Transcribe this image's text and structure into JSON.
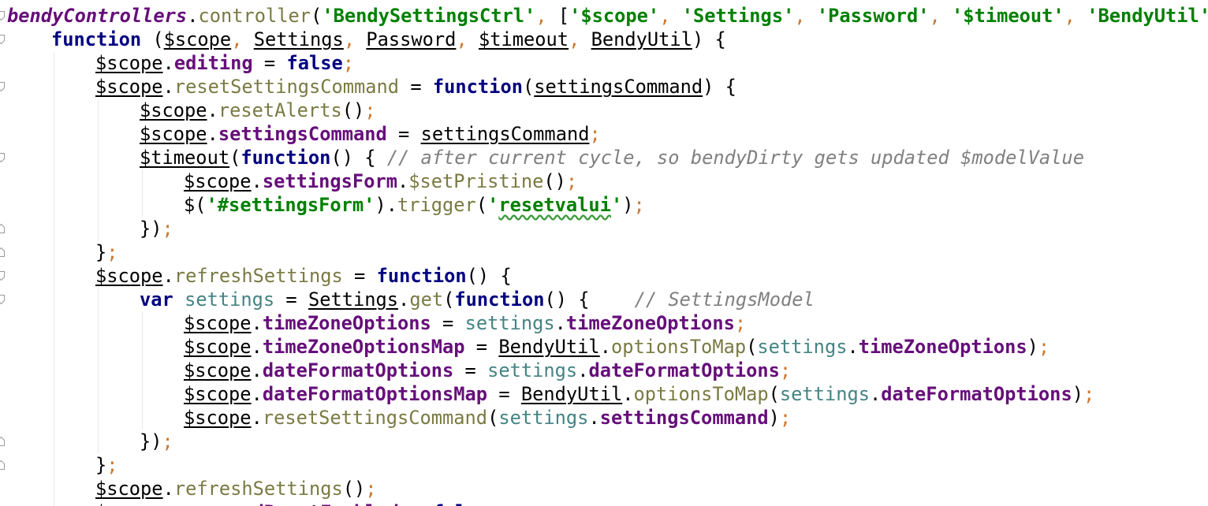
{
  "colors": {
    "keyword": "#000080",
    "string": "#008000",
    "comment": "#808080",
    "property": "#660e7a",
    "method": "#7a7a43",
    "variable": "#458383",
    "punct_orange": "#cc7832",
    "plain": "#000000",
    "indent_guide": "#e8e8e8",
    "gutter_icon": "#9a9a9a"
  },
  "code": {
    "lines": [
      {
        "indent": 0,
        "tokens": [
          {
            "t": "bendyControllers",
            "c": "property",
            "b": true,
            "i": true
          },
          {
            "t": ".",
            "c": "plain"
          },
          {
            "t": "controller",
            "c": "method"
          },
          {
            "t": "(",
            "c": "plain"
          },
          {
            "t": "'BendySettingsCtrl'",
            "c": "string",
            "b": true
          },
          {
            "t": ", ",
            "c": "punct_orange"
          },
          {
            "t": "[",
            "c": "plain"
          },
          {
            "t": "'$scope'",
            "c": "string",
            "b": true
          },
          {
            "t": ", ",
            "c": "punct_orange"
          },
          {
            "t": "'Settings'",
            "c": "string",
            "b": true
          },
          {
            "t": ", ",
            "c": "punct_orange"
          },
          {
            "t": "'Password'",
            "c": "string",
            "b": true
          },
          {
            "t": ", ",
            "c": "punct_orange"
          },
          {
            "t": "'$timeout'",
            "c": "string",
            "b": true
          },
          {
            "t": ", ",
            "c": "punct_orange"
          },
          {
            "t": "'BendyUtil'",
            "c": "string",
            "b": true
          },
          {
            "t": ",",
            "c": "punct_orange"
          }
        ]
      },
      {
        "indent": 1,
        "tokens": [
          {
            "t": "function",
            "c": "keyword",
            "b": true
          },
          {
            "t": " (",
            "c": "plain"
          },
          {
            "t": "$scope",
            "c": "plain",
            "u": true
          },
          {
            "t": ", ",
            "c": "punct_orange"
          },
          {
            "t": "Settings",
            "c": "plain",
            "u": true
          },
          {
            "t": ", ",
            "c": "punct_orange"
          },
          {
            "t": "Password",
            "c": "plain",
            "u": true
          },
          {
            "t": ", ",
            "c": "punct_orange"
          },
          {
            "t": "$timeout",
            "c": "plain",
            "u": true
          },
          {
            "t": ", ",
            "c": "punct_orange"
          },
          {
            "t": "BendyUtil",
            "c": "plain",
            "u": true
          },
          {
            "t": ") {",
            "c": "plain"
          }
        ]
      },
      {
        "indent": 2,
        "tokens": [
          {
            "t": "$scope",
            "c": "plain",
            "u": true
          },
          {
            "t": ".",
            "c": "plain"
          },
          {
            "t": "editing",
            "c": "property",
            "b": true
          },
          {
            "t": " = ",
            "c": "plain"
          },
          {
            "t": "false",
            "c": "keyword",
            "b": true
          },
          {
            "t": ";",
            "c": "punct_orange"
          }
        ]
      },
      {
        "indent": 2,
        "tokens": [
          {
            "t": "$scope",
            "c": "plain",
            "u": true
          },
          {
            "t": ".",
            "c": "plain"
          },
          {
            "t": "resetSettingsCommand",
            "c": "method"
          },
          {
            "t": " = ",
            "c": "plain"
          },
          {
            "t": "function",
            "c": "keyword",
            "b": true
          },
          {
            "t": "(",
            "c": "plain"
          },
          {
            "t": "settingsCommand",
            "c": "plain",
            "u": true
          },
          {
            "t": ") {",
            "c": "plain"
          }
        ]
      },
      {
        "indent": 3,
        "tokens": [
          {
            "t": "$scope",
            "c": "plain",
            "u": true
          },
          {
            "t": ".",
            "c": "plain"
          },
          {
            "t": "resetAlerts",
            "c": "method"
          },
          {
            "t": "()",
            "c": "plain"
          },
          {
            "t": ";",
            "c": "punct_orange"
          }
        ]
      },
      {
        "indent": 3,
        "tokens": [
          {
            "t": "$scope",
            "c": "plain",
            "u": true
          },
          {
            "t": ".",
            "c": "plain"
          },
          {
            "t": "settingsCommand",
            "c": "property",
            "b": true
          },
          {
            "t": " = ",
            "c": "plain"
          },
          {
            "t": "settingsCommand",
            "c": "plain",
            "u": true
          },
          {
            "t": ";",
            "c": "punct_orange"
          }
        ]
      },
      {
        "indent": 3,
        "tokens": [
          {
            "t": "$timeout",
            "c": "plain",
            "u": true
          },
          {
            "t": "(",
            "c": "plain"
          },
          {
            "t": "function",
            "c": "keyword",
            "b": true
          },
          {
            "t": "() { ",
            "c": "plain"
          },
          {
            "t": "// after current cycle, so bendyDirty gets updated $modelValue",
            "c": "comment",
            "i": true
          }
        ]
      },
      {
        "indent": 4,
        "tokens": [
          {
            "t": "$scope",
            "c": "plain",
            "u": true
          },
          {
            "t": ".",
            "c": "plain"
          },
          {
            "t": "settingsForm",
            "c": "property",
            "b": true
          },
          {
            "t": ".",
            "c": "plain"
          },
          {
            "t": "$setPristine",
            "c": "method"
          },
          {
            "t": "()",
            "c": "plain"
          },
          {
            "t": ";",
            "c": "punct_orange"
          }
        ]
      },
      {
        "indent": 4,
        "tokens": [
          {
            "t": "$(",
            "c": "plain"
          },
          {
            "t": "'#settingsForm'",
            "c": "string",
            "b": true
          },
          {
            "t": ").",
            "c": "plain"
          },
          {
            "t": "trigger",
            "c": "method"
          },
          {
            "t": "(",
            "c": "plain"
          },
          {
            "t": "'",
            "c": "string",
            "b": true
          },
          {
            "t": "resetvalui",
            "c": "string",
            "b": true,
            "wavy": true
          },
          {
            "t": "'",
            "c": "string",
            "b": true
          },
          {
            "t": ")",
            "c": "plain"
          },
          {
            "t": ";",
            "c": "punct_orange"
          }
        ]
      },
      {
        "indent": 3,
        "tokens": [
          {
            "t": "})",
            "c": "plain"
          },
          {
            "t": ";",
            "c": "punct_orange"
          }
        ]
      },
      {
        "indent": 2,
        "tokens": [
          {
            "t": "}",
            "c": "plain"
          },
          {
            "t": ";",
            "c": "punct_orange"
          }
        ]
      },
      {
        "indent": 2,
        "tokens": [
          {
            "t": "$scope",
            "c": "plain",
            "u": true
          },
          {
            "t": ".",
            "c": "plain"
          },
          {
            "t": "refreshSettings",
            "c": "method"
          },
          {
            "t": " = ",
            "c": "plain"
          },
          {
            "t": "function",
            "c": "keyword",
            "b": true
          },
          {
            "t": "() {",
            "c": "plain"
          }
        ]
      },
      {
        "indent": 3,
        "tokens": [
          {
            "t": "var",
            "c": "keyword",
            "b": true
          },
          {
            "t": " ",
            "c": "plain"
          },
          {
            "t": "settings",
            "c": "variable"
          },
          {
            "t": " = ",
            "c": "plain"
          },
          {
            "t": "Settings",
            "c": "plain",
            "u": true
          },
          {
            "t": ".",
            "c": "plain"
          },
          {
            "t": "get",
            "c": "method"
          },
          {
            "t": "(",
            "c": "plain"
          },
          {
            "t": "function",
            "c": "keyword",
            "b": true
          },
          {
            "t": "() {    ",
            "c": "plain"
          },
          {
            "t": "// SettingsModel",
            "c": "comment",
            "i": true
          }
        ]
      },
      {
        "indent": 4,
        "tokens": [
          {
            "t": "$scope",
            "c": "plain",
            "u": true
          },
          {
            "t": ".",
            "c": "plain"
          },
          {
            "t": "timeZoneOptions",
            "c": "property",
            "b": true
          },
          {
            "t": " = ",
            "c": "plain"
          },
          {
            "t": "settings",
            "c": "variable"
          },
          {
            "t": ".",
            "c": "plain"
          },
          {
            "t": "timeZoneOptions",
            "c": "property",
            "b": true
          },
          {
            "t": ";",
            "c": "punct_orange"
          }
        ]
      },
      {
        "indent": 4,
        "tokens": [
          {
            "t": "$scope",
            "c": "plain",
            "u": true
          },
          {
            "t": ".",
            "c": "plain"
          },
          {
            "t": "timeZoneOptionsMap",
            "c": "property",
            "b": true
          },
          {
            "t": " = ",
            "c": "plain"
          },
          {
            "t": "BendyUtil",
            "c": "plain",
            "u": true
          },
          {
            "t": ".",
            "c": "plain"
          },
          {
            "t": "optionsToMap",
            "c": "method"
          },
          {
            "t": "(",
            "c": "plain"
          },
          {
            "t": "settings",
            "c": "variable"
          },
          {
            "t": ".",
            "c": "plain"
          },
          {
            "t": "timeZoneOptions",
            "c": "property",
            "b": true
          },
          {
            "t": ")",
            "c": "plain"
          },
          {
            "t": ";",
            "c": "punct_orange"
          }
        ]
      },
      {
        "indent": 4,
        "tokens": [
          {
            "t": "$scope",
            "c": "plain",
            "u": true
          },
          {
            "t": ".",
            "c": "plain"
          },
          {
            "t": "dateFormatOptions",
            "c": "property",
            "b": true
          },
          {
            "t": " = ",
            "c": "plain"
          },
          {
            "t": "settings",
            "c": "variable"
          },
          {
            "t": ".",
            "c": "plain"
          },
          {
            "t": "dateFormatOptions",
            "c": "property",
            "b": true
          },
          {
            "t": ";",
            "c": "punct_orange"
          }
        ]
      },
      {
        "indent": 4,
        "tokens": [
          {
            "t": "$scope",
            "c": "plain",
            "u": true
          },
          {
            "t": ".",
            "c": "plain"
          },
          {
            "t": "dateFormatOptionsMap",
            "c": "property",
            "b": true
          },
          {
            "t": " = ",
            "c": "plain"
          },
          {
            "t": "BendyUtil",
            "c": "plain",
            "u": true
          },
          {
            "t": ".",
            "c": "plain"
          },
          {
            "t": "optionsToMap",
            "c": "method"
          },
          {
            "t": "(",
            "c": "plain"
          },
          {
            "t": "settings",
            "c": "variable"
          },
          {
            "t": ".",
            "c": "plain"
          },
          {
            "t": "dateFormatOptions",
            "c": "property",
            "b": true
          },
          {
            "t": ")",
            "c": "plain"
          },
          {
            "t": ";",
            "c": "punct_orange"
          }
        ]
      },
      {
        "indent": 4,
        "tokens": [
          {
            "t": "$scope",
            "c": "plain",
            "u": true
          },
          {
            "t": ".",
            "c": "plain"
          },
          {
            "t": "resetSettingsCommand",
            "c": "method"
          },
          {
            "t": "(",
            "c": "plain"
          },
          {
            "t": "settings",
            "c": "variable"
          },
          {
            "t": ".",
            "c": "plain"
          },
          {
            "t": "settingsCommand",
            "c": "property",
            "b": true
          },
          {
            "t": ")",
            "c": "plain"
          },
          {
            "t": ";",
            "c": "punct_orange"
          }
        ]
      },
      {
        "indent": 3,
        "tokens": [
          {
            "t": "})",
            "c": "plain"
          },
          {
            "t": ";",
            "c": "punct_orange"
          }
        ]
      },
      {
        "indent": 2,
        "tokens": [
          {
            "t": "}",
            "c": "plain"
          },
          {
            "t": ";",
            "c": "punct_orange"
          }
        ]
      },
      {
        "indent": 2,
        "tokens": [
          {
            "t": "$scope",
            "c": "plain",
            "u": true
          },
          {
            "t": ".",
            "c": "plain"
          },
          {
            "t": "refreshSettings",
            "c": "method"
          },
          {
            "t": "()",
            "c": "plain"
          },
          {
            "t": ";",
            "c": "punct_orange"
          }
        ]
      },
      {
        "indent": 2,
        "tokens": [
          {
            "t": "$scope",
            "c": "plain",
            "u": true
          },
          {
            "t": ".",
            "c": "plain"
          },
          {
            "t": "passwordResetEnabled",
            "c": "property",
            "b": true
          },
          {
            "t": " = ",
            "c": "plain"
          },
          {
            "t": "false",
            "c": "keyword",
            "b": true
          }
        ]
      }
    ],
    "gutter_markers": [
      {
        "line": 0,
        "icon": "fold-open-icon"
      },
      {
        "line": 1,
        "icon": "fold-open-icon"
      },
      {
        "line": 3,
        "icon": "fold-open-icon"
      },
      {
        "line": 6,
        "icon": "fold-open-icon"
      },
      {
        "line": 9,
        "icon": "fold-close-icon"
      },
      {
        "line": 10,
        "icon": "fold-close-icon"
      },
      {
        "line": 11,
        "icon": "fold-open-icon"
      },
      {
        "line": 12,
        "icon": "fold-open-icon"
      },
      {
        "line": 18,
        "icon": "fold-close-icon"
      },
      {
        "line": 19,
        "icon": "fold-close-icon"
      }
    ]
  }
}
